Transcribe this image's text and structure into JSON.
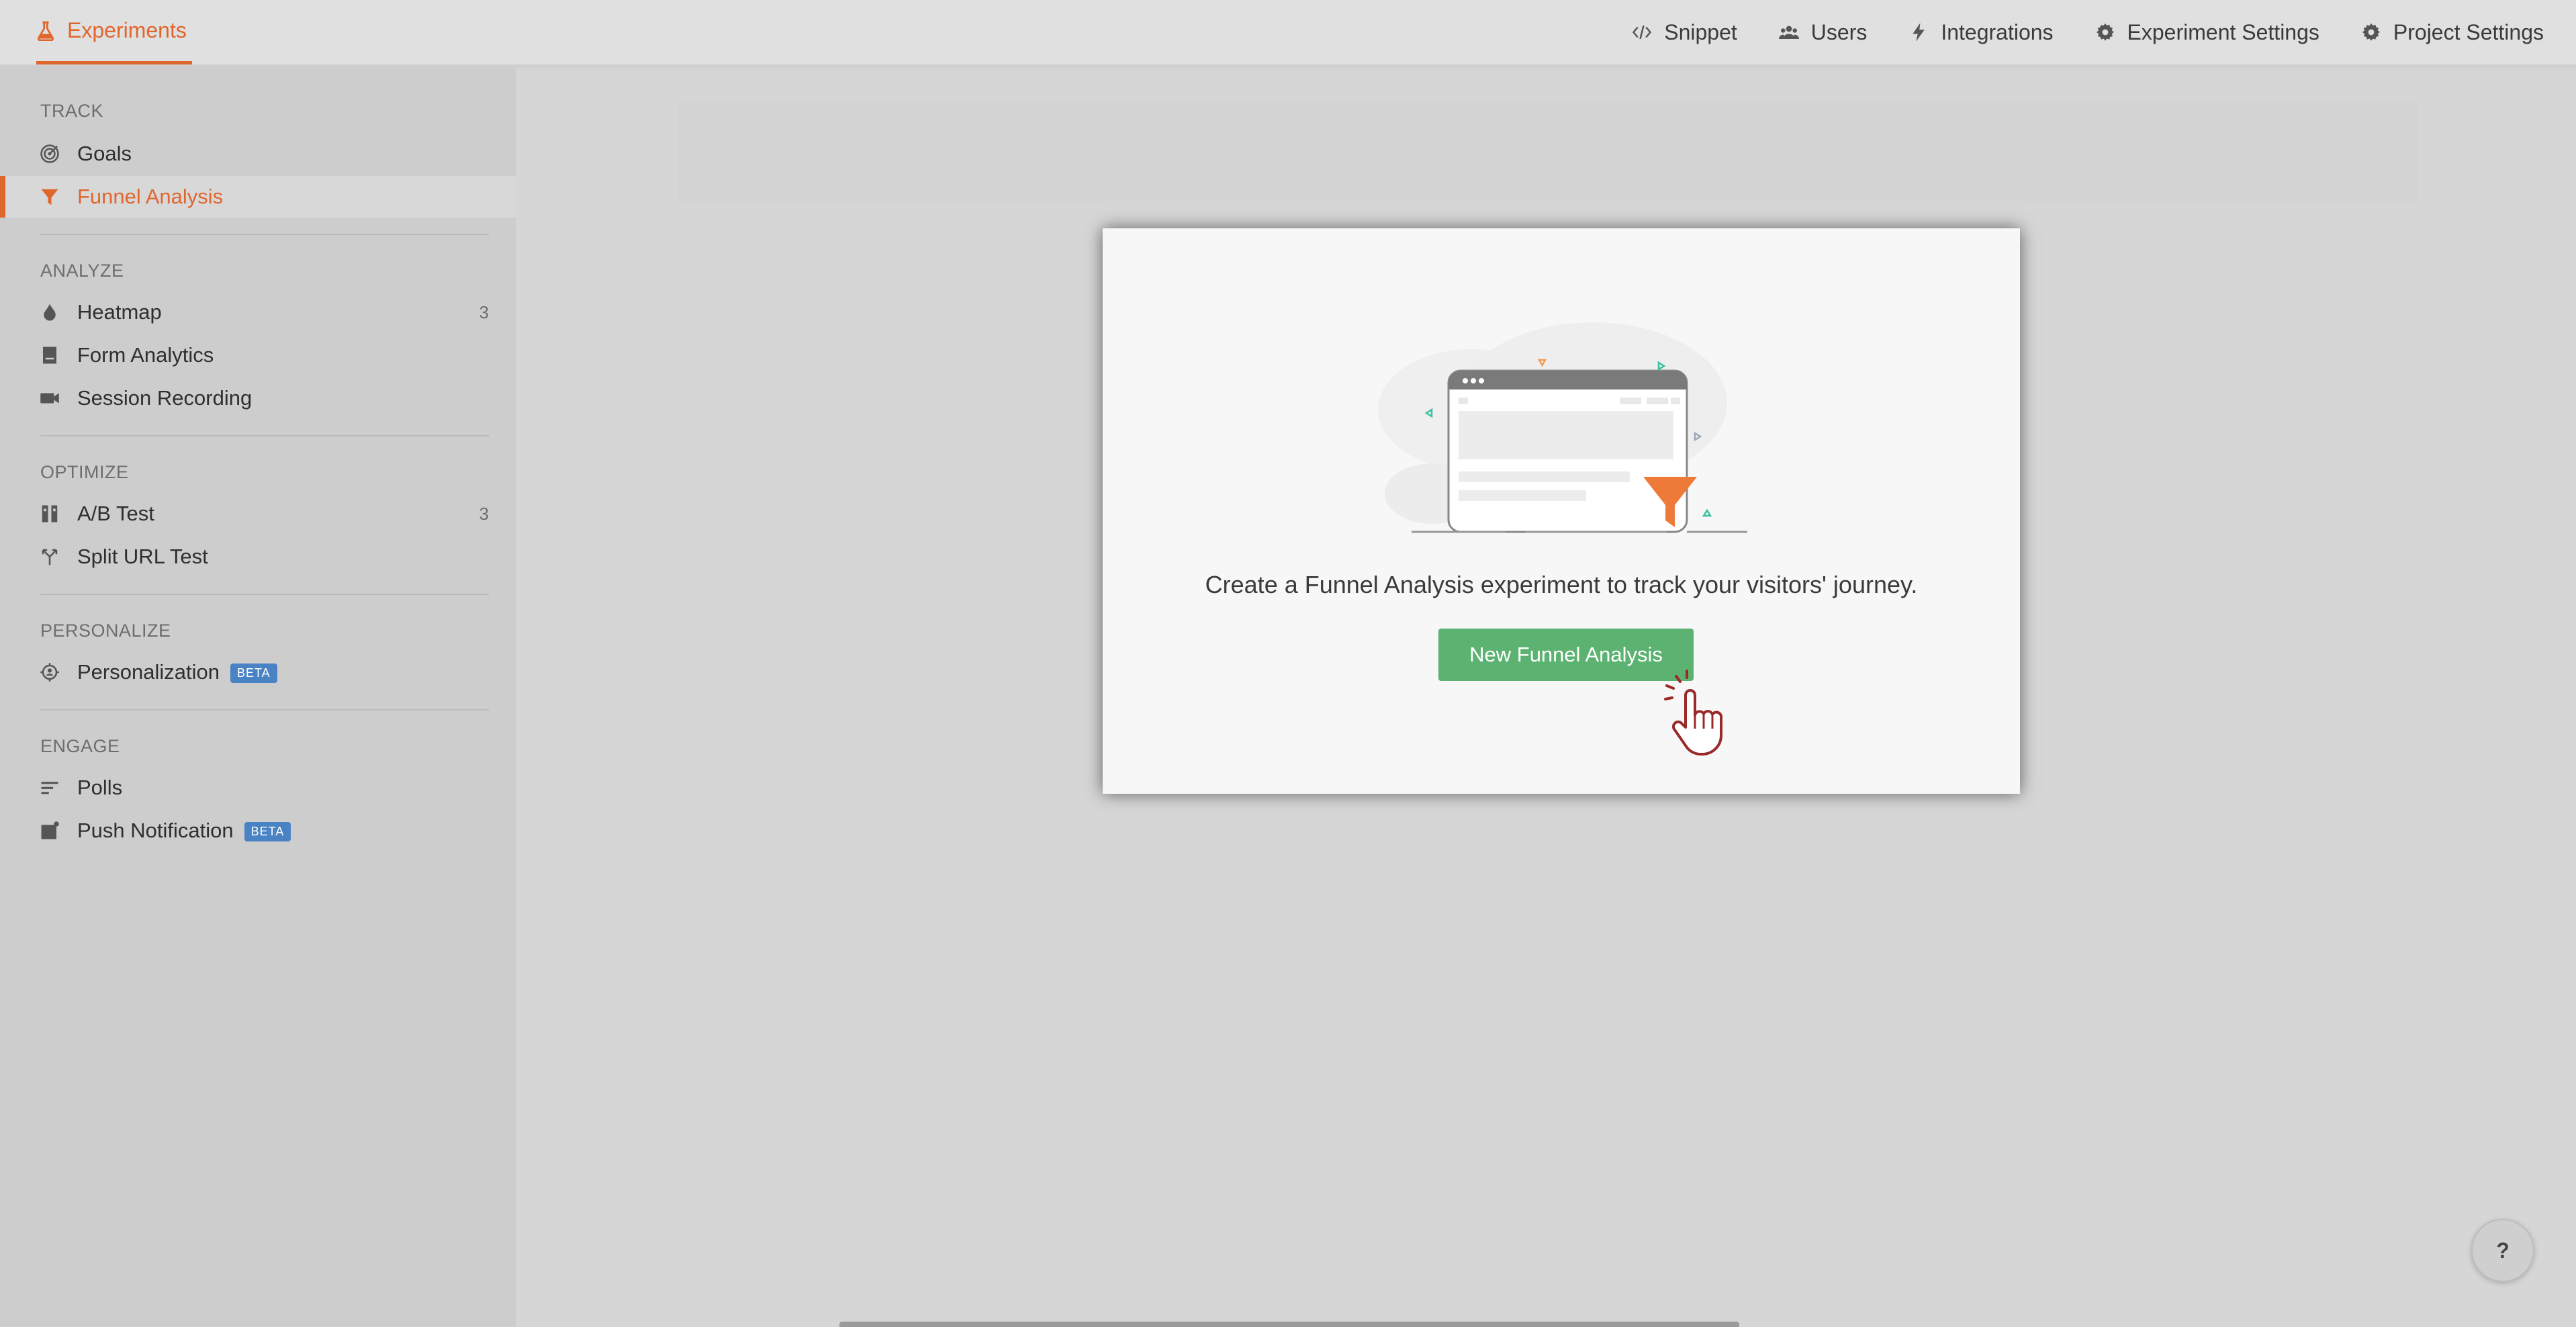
{
  "topbar": {
    "brand": "Experiments",
    "nav": [
      {
        "label": "Snippet",
        "icon": "code-icon"
      },
      {
        "label": "Users",
        "icon": "users-icon"
      },
      {
        "label": "Integrations",
        "icon": "bolt-icon"
      },
      {
        "label": "Experiment Settings",
        "icon": "gear-icon"
      },
      {
        "label": "Project Settings",
        "icon": "gear-icon"
      }
    ]
  },
  "sidebar": {
    "sections": [
      {
        "title": "TRACK",
        "items": [
          {
            "label": "Goals",
            "icon": "target-icon"
          },
          {
            "label": "Funnel Analysis",
            "icon": "funnel-icon",
            "active": true
          }
        ]
      },
      {
        "title": "ANALYZE",
        "items": [
          {
            "label": "Heatmap",
            "icon": "flame-icon",
            "count": "3"
          },
          {
            "label": "Form Analytics",
            "icon": "form-icon"
          },
          {
            "label": "Session Recording",
            "icon": "camera-icon"
          }
        ]
      },
      {
        "title": "OPTIMIZE",
        "items": [
          {
            "label": "A/B Test",
            "icon": "ab-test-icon",
            "count": "3"
          },
          {
            "label": "Split URL Test",
            "icon": "split-icon"
          }
        ]
      },
      {
        "title": "PERSONALIZE",
        "items": [
          {
            "label": "Personalization",
            "icon": "personalization-icon",
            "badge": "BETA"
          }
        ]
      },
      {
        "title": "ENGAGE",
        "items": [
          {
            "label": "Polls",
            "icon": "polls-icon"
          },
          {
            "label": "Push Notification",
            "icon": "push-icon",
            "badge": "BETA"
          }
        ]
      }
    ]
  },
  "modal": {
    "message": "Create a Funnel Analysis experiment to track your visitors' journey.",
    "button_label": "New Funnel Analysis"
  },
  "help": {
    "label": "?"
  },
  "colors": {
    "accent": "#e0662e",
    "primary_button": "#5cb270",
    "badge": "#4a83c4"
  }
}
